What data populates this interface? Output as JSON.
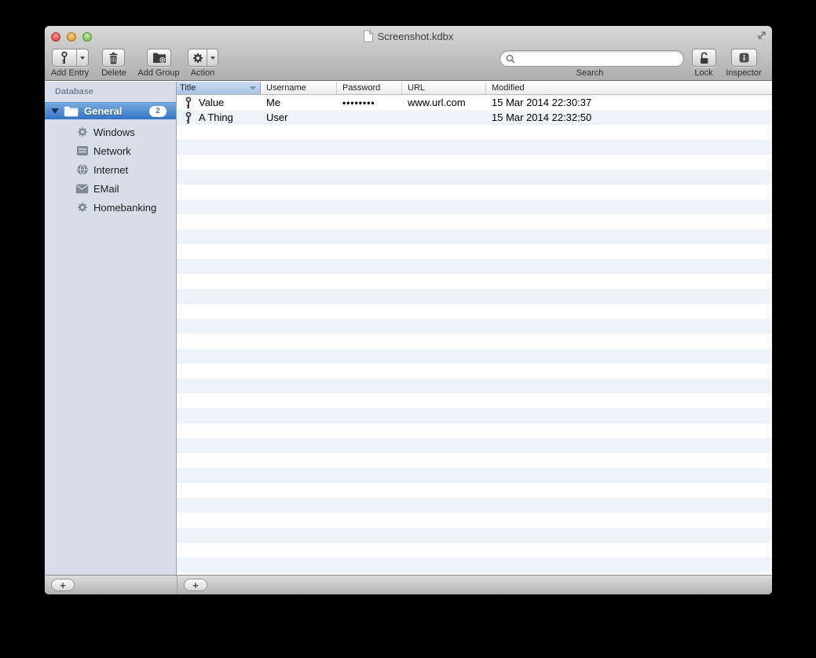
{
  "window": {
    "title": "Screenshot.kdbx",
    "controls": {
      "close": "close",
      "minimize": "minimize",
      "zoom": "zoom",
      "fullscreen": "enter-fullscreen"
    }
  },
  "toolbar": {
    "add_entry_label": "Add Entry",
    "delete_label": "Delete",
    "add_group_label": "Add Group",
    "action_label": "Action",
    "search_label": "Search",
    "search_value": "",
    "lock_label": "Lock",
    "inspector_label": "Inspector",
    "icons": {
      "add_entry": "key-icon",
      "delete": "trash-icon",
      "add_group": "folder-plus-icon",
      "action": "gear-icon",
      "search": "magnifier-icon",
      "lock": "open-padlock-icon",
      "inspector": "info-icon"
    }
  },
  "sidebar": {
    "header": "Database",
    "group": {
      "label": "General",
      "badge": "2",
      "icon": "folder-icon",
      "expanded": true
    },
    "items": [
      {
        "label": "Windows",
        "icon": "gear-icon"
      },
      {
        "label": "Network",
        "icon": "server-icon"
      },
      {
        "label": "Internet",
        "icon": "globe-icon"
      },
      {
        "label": "EMail",
        "icon": "mail-icon"
      },
      {
        "label": "Homebanking",
        "icon": "gear-icon"
      }
    ]
  },
  "table": {
    "columns": {
      "title": "Title",
      "username": "Username",
      "password": "Password",
      "url": "URL",
      "modified": "Modified"
    },
    "sort": {
      "column": "Title",
      "direction": "descending"
    },
    "rows": [
      {
        "icon": "key-icon",
        "title": "Value",
        "username": "Me",
        "password_masked": "••••••••",
        "url": "www.url.com",
        "modified": "15 Mar 2014 22:30:37"
      },
      {
        "icon": "key-icon",
        "title": "A Thing",
        "username": "User",
        "password_masked": "",
        "url": "",
        "modified": "15 Mar 2014 22:32:50"
      }
    ]
  },
  "footer": {
    "add_group_button": "+",
    "add_entry_button": "+"
  },
  "colors": {
    "selection_blue_top": "#77aadf",
    "selection_blue_bottom": "#3373c3",
    "stripe_blue": "#eef3fa",
    "sidebar_bg": "#d7dee8",
    "sorted_header_bg": "#b8cfe9",
    "toolbar_gradient_top": "#d9d9d9",
    "toolbar_gradient_bottom": "#aeaeae"
  }
}
